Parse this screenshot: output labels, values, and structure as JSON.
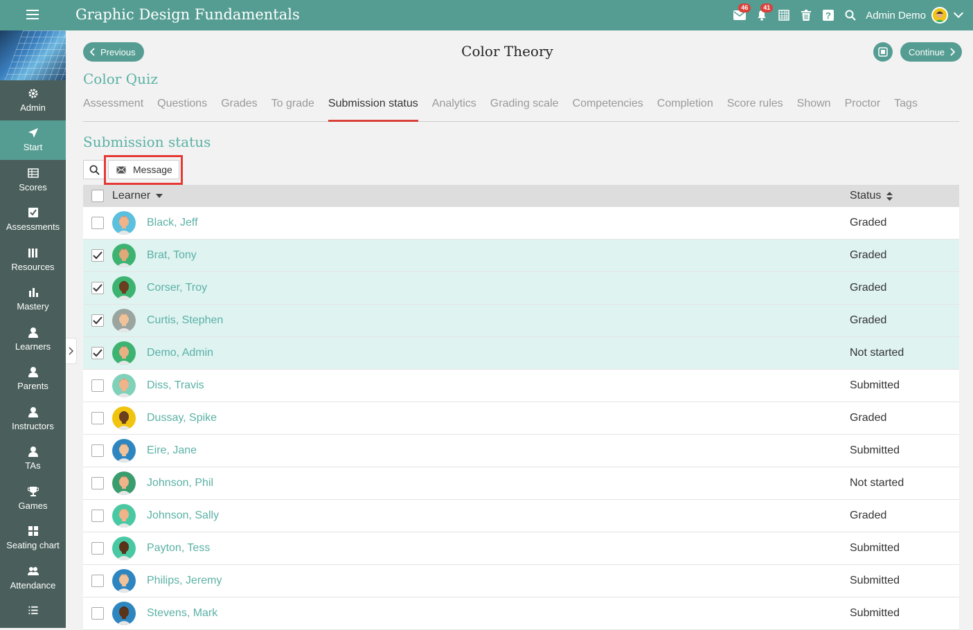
{
  "header": {
    "app_title": "Graphic Design Fundamentals",
    "mail_count": "46",
    "notif_count": "41",
    "user_name": "Admin Demo"
  },
  "sidebar": {
    "items": [
      {
        "label": "Admin",
        "icon": "gear-icon"
      },
      {
        "label": "Start",
        "icon": "location-arrow-icon"
      },
      {
        "label": "Scores",
        "icon": "table-icon"
      },
      {
        "label": "Assessments",
        "icon": "checkbox-icon"
      },
      {
        "label": "Resources",
        "icon": "books-icon"
      },
      {
        "label": "Mastery",
        "icon": "bar-chart-icon"
      },
      {
        "label": "Learners",
        "icon": "person-icon"
      },
      {
        "label": "Parents",
        "icon": "person-icon"
      },
      {
        "label": "Instructors",
        "icon": "person-icon"
      },
      {
        "label": "TAs",
        "icon": "person-icon"
      },
      {
        "label": "Games",
        "icon": "trophy-icon"
      },
      {
        "label": "Seating chart",
        "icon": "grid-icon"
      },
      {
        "label": "Attendance",
        "icon": "people-icon"
      }
    ],
    "active": "Start"
  },
  "page": {
    "prev_label": "Previous",
    "title": "Color Theory",
    "continue_label": "Continue",
    "subtitle": "Color Quiz",
    "section_title": "Submission status",
    "message_label": "Message"
  },
  "tabs": [
    "Assessment",
    "Questions",
    "Grades",
    "To grade",
    "Submission status",
    "Analytics",
    "Grading scale",
    "Competencies",
    "Completion",
    "Score rules",
    "Shown",
    "Proctor",
    "Tags"
  ],
  "active_tab": "Submission status",
  "table": {
    "col_learner": "Learner",
    "col_status": "Status",
    "rows": [
      {
        "name": "Black, Jeff",
        "status": "Graded",
        "checked": false,
        "bg": "#5bc0de",
        "skin": "#f0b38a",
        "hair": "#c0392b"
      },
      {
        "name": "Brat, Tony",
        "status": "Graded",
        "checked": true,
        "bg": "#3cb371",
        "skin": "#e0a97a",
        "hair": "#2c2c2c"
      },
      {
        "name": "Corser, Troy",
        "status": "Graded",
        "checked": true,
        "bg": "#3cb371",
        "skin": "#6b3e1f",
        "hair": "#111111"
      },
      {
        "name": "Curtis, Stephen",
        "status": "Graded",
        "checked": true,
        "bg": "#9aa5a0",
        "skin": "#f0c29a",
        "hair": "#8a5a2b"
      },
      {
        "name": "Demo, Admin",
        "status": "Not started",
        "checked": true,
        "bg": "#3cb371",
        "skin": "#e8b184",
        "hair": "#4a3520"
      },
      {
        "name": "Diss, Travis",
        "status": "Submitted",
        "checked": false,
        "bg": "#7fd1b9",
        "skin": "#f0b38a",
        "hair": "#b5651d"
      },
      {
        "name": "Dussay, Spike",
        "status": "Graded",
        "checked": false,
        "bg": "#f1c40f",
        "skin": "#6b3e1f",
        "hair": "#222222"
      },
      {
        "name": "Eire, Jane",
        "status": "Submitted",
        "checked": false,
        "bg": "#2e86c1",
        "skin": "#f0c29a",
        "hair": "#111111"
      },
      {
        "name": "Johnson, Phil",
        "status": "Not started",
        "checked": false,
        "bg": "#3a9d6e",
        "skin": "#f0b38a",
        "hair": "#7a4a1f"
      },
      {
        "name": "Johnson, Sally",
        "status": "Graded",
        "checked": false,
        "bg": "#48c9a3",
        "skin": "#f0b38a",
        "hair": "#e67e22"
      },
      {
        "name": "Payton, Tess",
        "status": "Submitted",
        "checked": false,
        "bg": "#48c9a3",
        "skin": "#5a3318",
        "hair": "#111111"
      },
      {
        "name": "Philips, Jeremy",
        "status": "Submitted",
        "checked": false,
        "bg": "#2e86c1",
        "skin": "#f0c29a",
        "hair": "#222222"
      },
      {
        "name": "Stevens, Mark",
        "status": "Submitted",
        "checked": false,
        "bg": "#2e86c1",
        "skin": "#5a3318",
        "hair": "#111111"
      }
    ]
  },
  "colors": {
    "teal": "#559d92",
    "accent_text": "#5ab1a5",
    "sidebar_bg": "#4a5f5b",
    "tab_underline": "#d9413a",
    "highlight_box": "#e53935"
  }
}
